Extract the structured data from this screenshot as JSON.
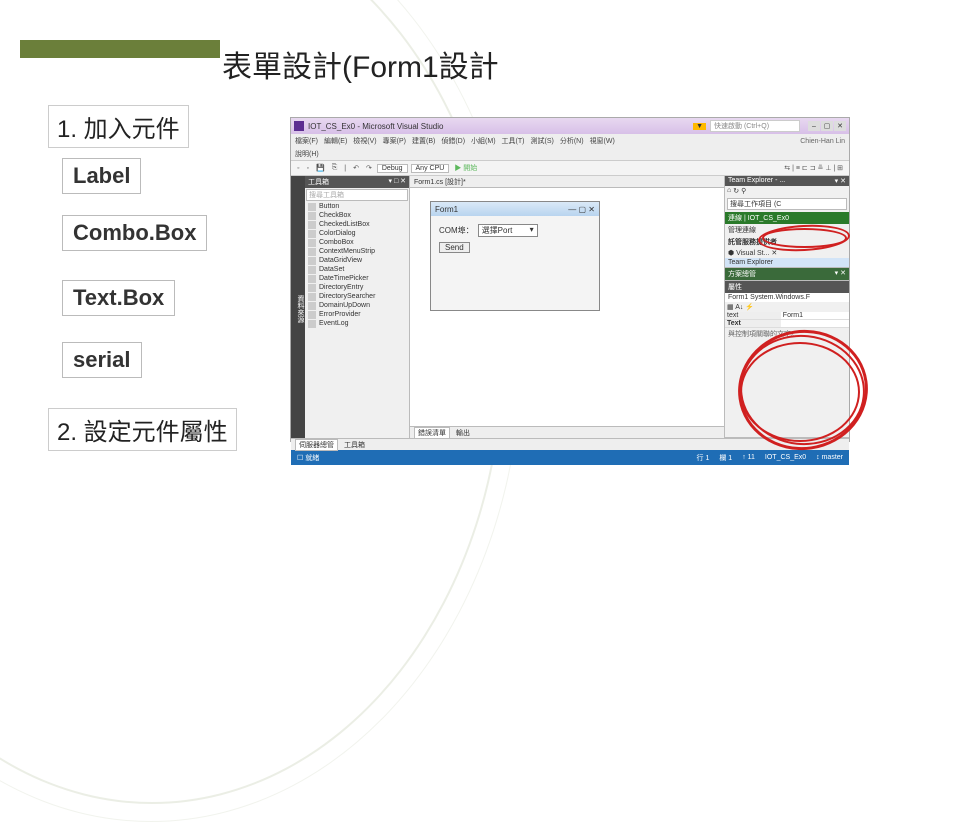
{
  "slide": {
    "title": "表單設計(Form1設計",
    "step1": "1. 加入元件",
    "step2": "2. 設定元件屬性",
    "components": [
      "Label",
      "Combo.Box",
      "Text.Box",
      "serial"
    ]
  },
  "vs": {
    "app_title": "IOT_CS_Ex0 - Microsoft Visual Studio",
    "quick_launch_badge": "▼",
    "quick_launch_placeholder": "快速啟動 (Ctrl+Q)",
    "user": "Chien-Han Lin",
    "menu": [
      "檔案(F)",
      "編輯(E)",
      "檢視(V)",
      "專案(P)",
      "建置(B)",
      "偵錯(D)",
      "小組(M)",
      "工具(T)",
      "測試(S)",
      "分析(N)",
      "視窗(W)"
    ],
    "help": "說明(H)",
    "toolbar": {
      "config": "Debug",
      "platform": "Any CPU",
      "start": "▶ 開始"
    },
    "toolbox": {
      "title": "工具箱",
      "search": "搜尋工具箱",
      "items": [
        "Button",
        "CheckBox",
        "CheckedListBox",
        "ColorDialog",
        "ComboBox",
        "ContextMenuStrip",
        "DataGridView",
        "DataSet",
        "DateTimePicker",
        "DirectoryEntry",
        "DirectorySearcher",
        "DomainUpDown",
        "ErrorProvider",
        "EventLog"
      ]
    },
    "doc_tab": "Form1.cs [設計]*",
    "form": {
      "title": "Form1",
      "label": "COM埠：",
      "combo": "選擇Port",
      "send": "Send"
    },
    "team": {
      "title": "Team Explorer - ...",
      "search_label": "搜尋工作項目 (C",
      "connect": "連線",
      "proj": "IOT_CS_Ex0",
      "manage": "管理連線",
      "provider": "託管服務提供者",
      "vsitem": "Visual St...",
      "teitem": "Team Explorer"
    },
    "solution": {
      "title": "方案總管"
    },
    "properties": {
      "title": "屬性",
      "obj": "Form1 System.Windows.F",
      "rows": [
        {
          "k": "text",
          "v": "Form1"
        },
        {
          "k": "Text",
          "v": ""
        }
      ],
      "desc": "與控制項關聯的文字。"
    },
    "error_tabs": [
      "伺服器總管",
      "工具箱"
    ],
    "output_tabs": [
      "錯誤清單",
      "輸出"
    ],
    "status": {
      "ready": "☐ 就緒",
      "line": "行 1",
      "col": "欄 1",
      "pub": "↑ 11",
      "proj": "IOT_CS_Ex0",
      "branch": "↕ master"
    }
  }
}
